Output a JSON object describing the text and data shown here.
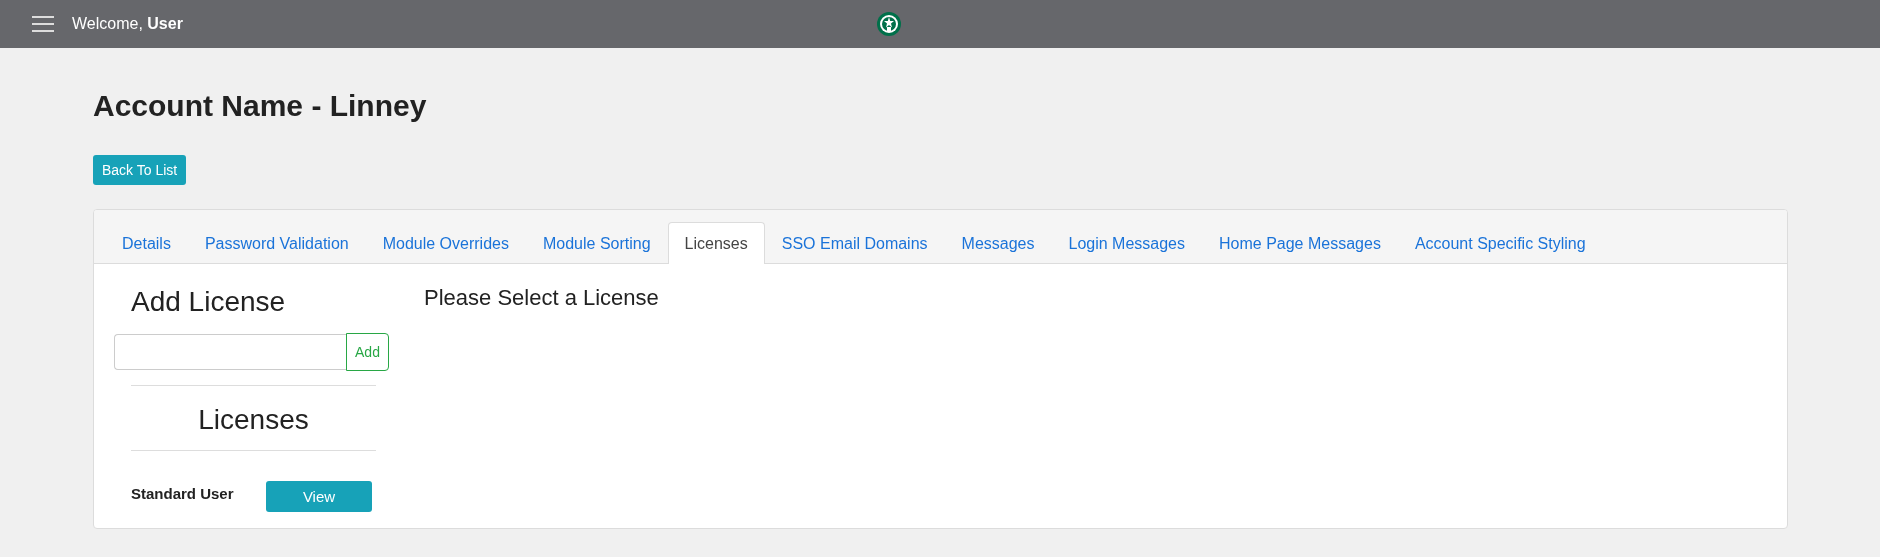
{
  "topbar": {
    "greeting": "Welcome,",
    "user": "User"
  },
  "page": {
    "title": "Account Name - Linney",
    "back_button": "Back To List"
  },
  "tabs": [
    {
      "label": "Details",
      "selected": false
    },
    {
      "label": "Password Validation",
      "selected": false
    },
    {
      "label": "Module Overrides",
      "selected": false
    },
    {
      "label": "Module Sorting",
      "selected": false
    },
    {
      "label": "Licenses",
      "selected": true
    },
    {
      "label": "SSO Email Domains",
      "selected": false
    },
    {
      "label": "Messages",
      "selected": false
    },
    {
      "label": "Login Messages",
      "selected": false
    },
    {
      "label": "Home Page Messages",
      "selected": false
    },
    {
      "label": "Account Specific Styling",
      "selected": false
    }
  ],
  "add_license": {
    "heading": "Add License",
    "button": "Add"
  },
  "licenses": {
    "heading": "Licenses",
    "items": [
      {
        "name": "Standard User",
        "button": "View"
      }
    ]
  },
  "detail": {
    "heading": "Please Select a License"
  }
}
